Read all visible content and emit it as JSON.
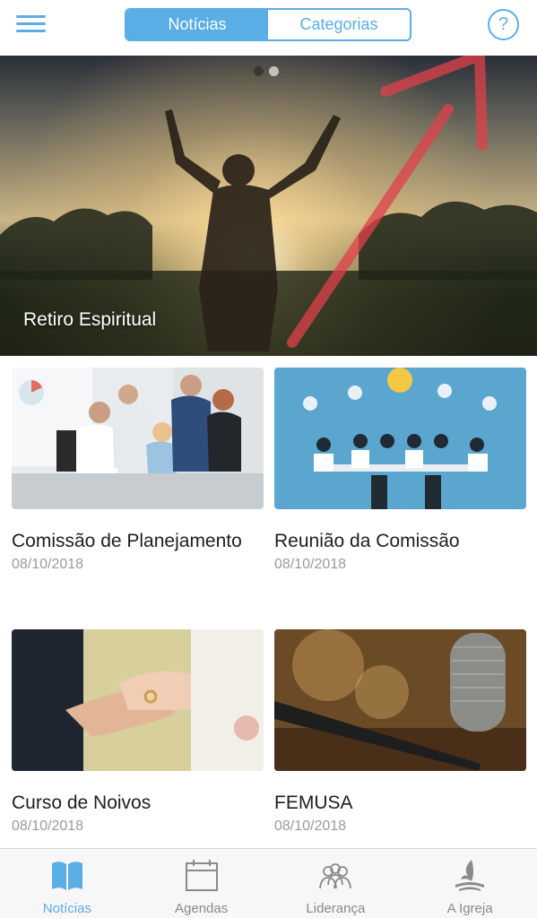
{
  "header": {
    "menu_icon": "hamburger-menu-icon",
    "tabs": [
      {
        "label": "Notícias",
        "active": true
      },
      {
        "label": "Categorias",
        "active": false
      }
    ],
    "help_icon": "question-mark-icon",
    "help_glyph": "?",
    "accent_color": "#5aaee6"
  },
  "hero": {
    "title": "Retiro Espiritual",
    "carousel_index": 1,
    "carousel_total": 2
  },
  "news": [
    {
      "title": "Comissão de Planejamento",
      "date": "08/10/2018"
    },
    {
      "title": "Reunião da Comissão",
      "date": "08/10/2018"
    },
    {
      "title": "Curso de Noivos",
      "date": "08/10/2018"
    },
    {
      "title": "FEMUSA",
      "date": "08/10/2018"
    }
  ],
  "tabbar": [
    {
      "label": "Notícias",
      "icon": "open-book-icon",
      "active": true
    },
    {
      "label": "Agendas",
      "icon": "calendar-icon",
      "active": false
    },
    {
      "label": "Liderança",
      "icon": "people-group-icon",
      "active": false
    },
    {
      "label": "A Igreja",
      "icon": "church-logo-icon",
      "active": false
    }
  ]
}
